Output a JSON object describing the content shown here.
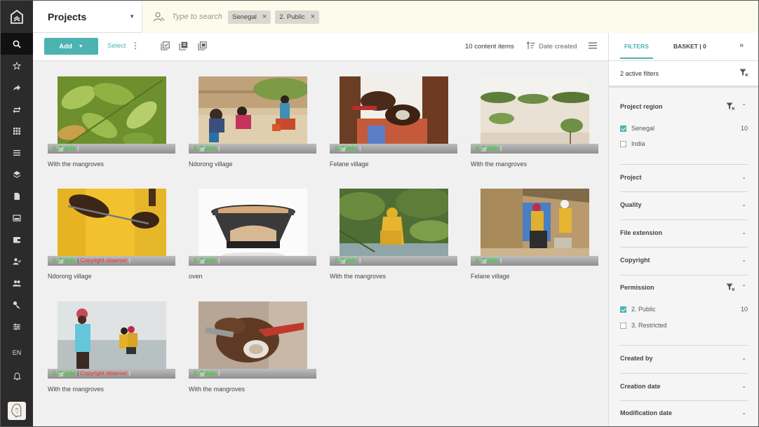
{
  "topbar": {
    "project_label": "Projects",
    "search_placeholder": "Type to search",
    "chips": [
      "Senegal",
      "2. Public"
    ]
  },
  "leftnav": {
    "language": "EN",
    "icons": [
      "search-icon",
      "star-icon",
      "share-icon",
      "transfer-icon",
      "grid-icon",
      "list-icon",
      "layers-icon",
      "document-icon",
      "image-icon",
      "wallet-icon",
      "user-check-icon",
      "users-icon",
      "key-icon",
      "sliders-icon"
    ]
  },
  "toolbar": {
    "add_label": "Add",
    "select_label": "Select",
    "count_label": "10 content items",
    "sort_label": "Date created"
  },
  "items": [
    {
      "permission": "2. Public",
      "copyright": "",
      "ext": ".tif",
      "caption": "With the mangroves"
    },
    {
      "permission": "2. Public",
      "copyright": "",
      "ext": ".tif",
      "caption": "Ndorong village"
    },
    {
      "permission": "2. Public",
      "copyright": "",
      "ext": ".tif",
      "caption": "Felane village"
    },
    {
      "permission": "2. Public",
      "copyright": "",
      "ext": ".tif",
      "caption": "With the mangroves"
    },
    {
      "permission": "2. Public",
      "copyright": "Copyright observe!",
      "ext": ".tif",
      "caption": "Ndorong village"
    },
    {
      "permission": "2. Public",
      "copyright": "",
      "ext": ".tif",
      "caption": "oven"
    },
    {
      "permission": "2. Public",
      "copyright": "",
      "ext": ".tif",
      "caption": "With the mangroves"
    },
    {
      "permission": "2. Public",
      "copyright": "",
      "ext": ".tif",
      "caption": "Felane village"
    },
    {
      "permission": "2. Public",
      "copyright": "Copyright observe!",
      "ext": ".tif",
      "caption": "With the mangroves"
    },
    {
      "permission": "2. Public",
      "copyright": "",
      "ext": ".tif",
      "caption": "With the mangroves"
    }
  ],
  "filters": {
    "tab_filters": "FILTERS",
    "tab_basket": "BASKET | 0",
    "active_label": "2 active filters",
    "sections": {
      "region": {
        "title": "Project region",
        "options": [
          {
            "label": "Senegal",
            "count": "10",
            "checked": true
          },
          {
            "label": "India",
            "count": "",
            "checked": false
          }
        ]
      },
      "project": {
        "title": "Project"
      },
      "quality": {
        "title": "Quality"
      },
      "file_extension": {
        "title": "File extension"
      },
      "copyright": {
        "title": "Copyright"
      },
      "permission": {
        "title": "Permission",
        "options": [
          {
            "label": "2. Public",
            "count": "10",
            "checked": true
          },
          {
            "label": "3. Restricted",
            "count": "",
            "checked": false
          }
        ]
      },
      "created_by": {
        "title": "Created by"
      },
      "creation_date": {
        "title": "Creation date"
      },
      "modification_date": {
        "title": "Modification date"
      }
    }
  }
}
